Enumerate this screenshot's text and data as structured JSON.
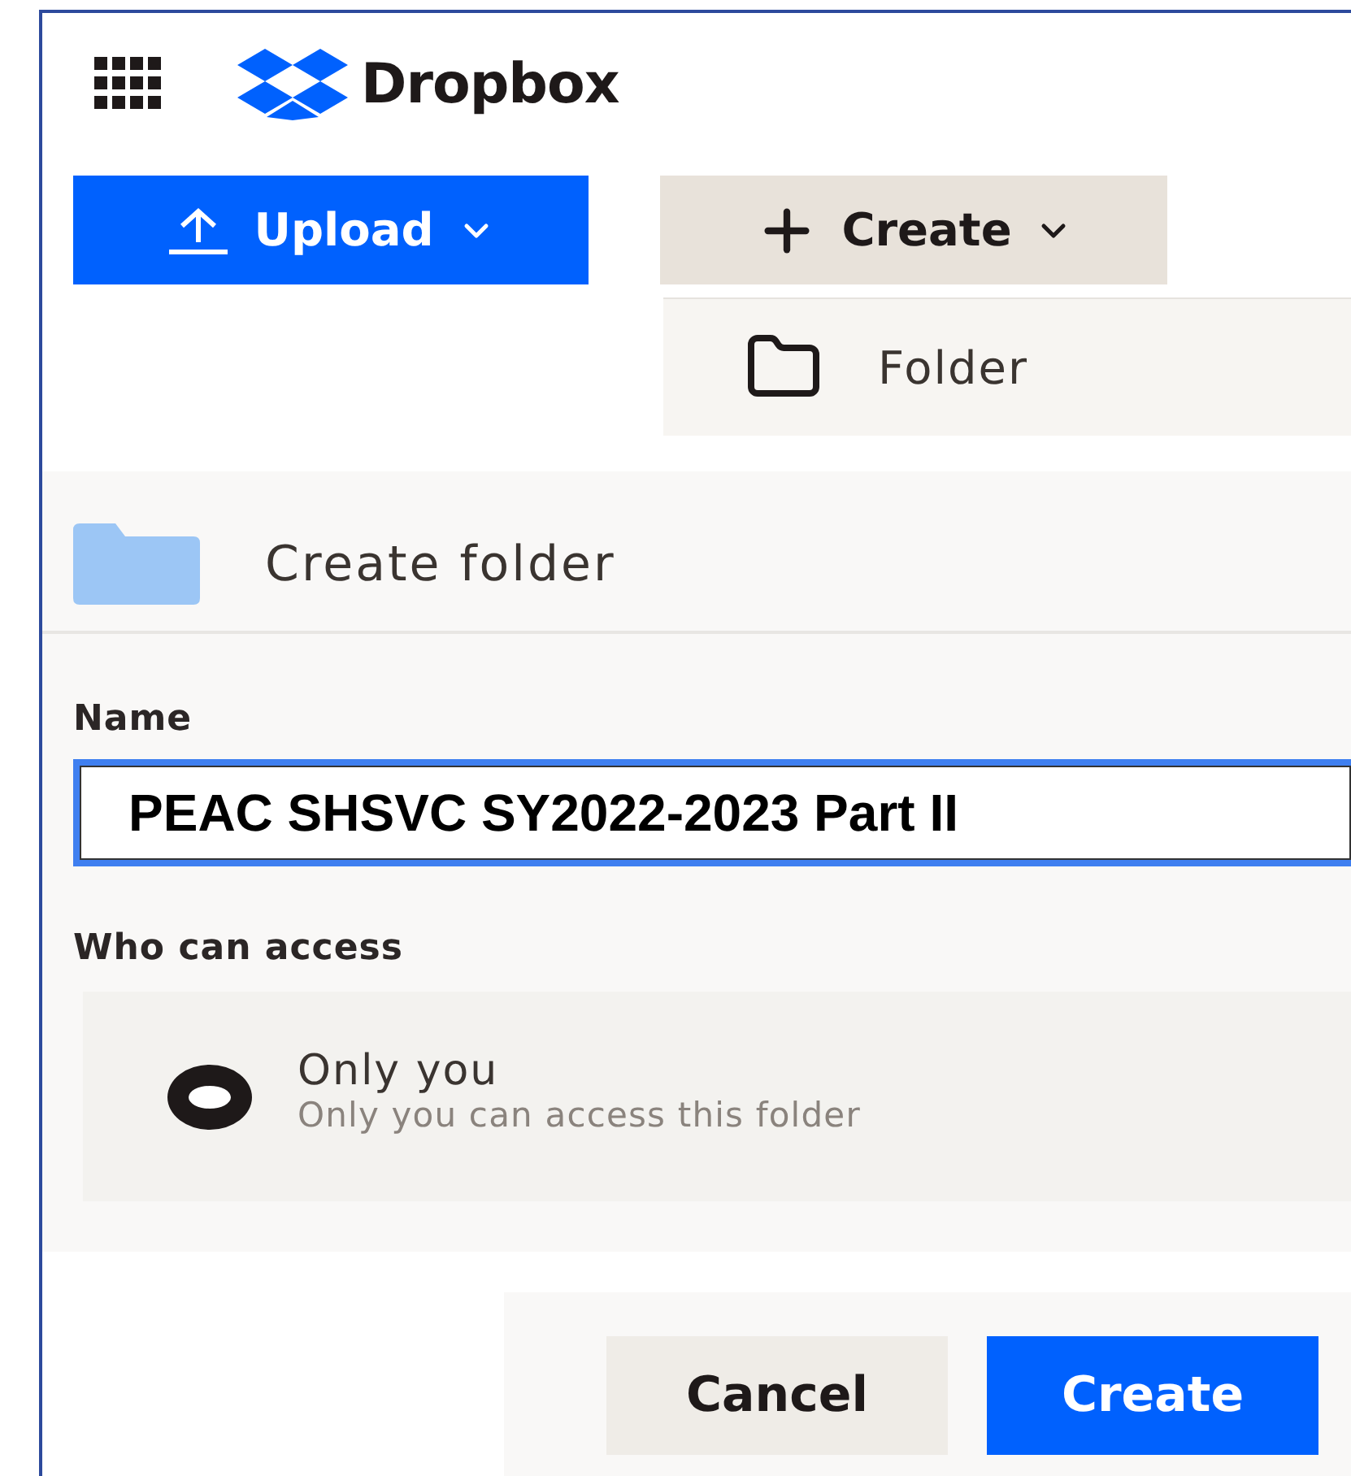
{
  "app": {
    "brand": "Dropbox"
  },
  "toolbar": {
    "upload": "Upload",
    "create": "Create"
  },
  "create_menu": {
    "items": [
      {
        "label": "Folder"
      }
    ]
  },
  "dialog": {
    "title": "Create folder",
    "name_label": "Name",
    "name_value": "PEAC SHSVC SY2022-2023 Part II",
    "access_label": "Who can access",
    "access_options": [
      {
        "title": "Only you",
        "description": "Only you can access this folder",
        "selected": true
      }
    ],
    "buttons": [
      {
        "label": "Cancel",
        "kind": "secondary"
      },
      {
        "label": "Create",
        "kind": "primary"
      }
    ]
  }
}
